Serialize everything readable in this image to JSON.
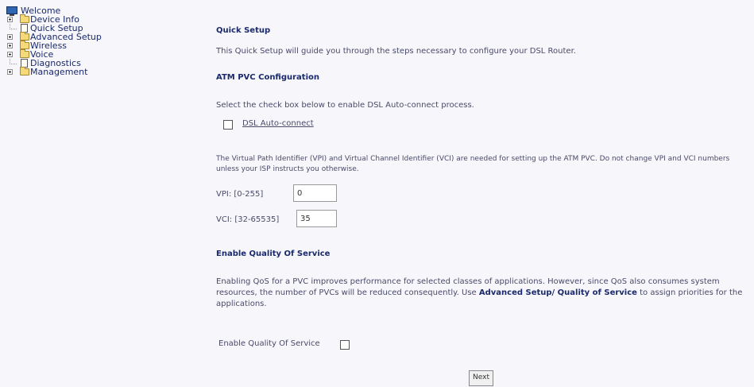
{
  "sidebar": {
    "items": [
      {
        "label": "Welcome"
      },
      {
        "label": "Device Info"
      },
      {
        "label": "Quick Setup"
      },
      {
        "label": "Advanced Setup"
      },
      {
        "label": "Wireless"
      },
      {
        "label": "Voice"
      },
      {
        "label": "Diagnostics"
      },
      {
        "label": "Management"
      }
    ]
  },
  "main": {
    "title": "Quick Setup",
    "intro": "This Quick Setup will guide you through the steps necessary to configure your DSL Router.",
    "atm": {
      "heading": "ATM PVC Configuration",
      "instruction": "Select the check box below to enable DSL Auto-connect process.",
      "auto_connect_label": "DSL Auto-connect",
      "description": "The Virtual Path Identifier (VPI) and Virtual Channel Identifier (VCI) are needed for setting up the ATM PVC. Do not change VPI and VCI numbers unless your ISP instructs you otherwise.",
      "vpi_label": "VPI: [0-255]",
      "vpi_value": "0",
      "vci_label": "VCI: [32-65535]",
      "vci_value": "35"
    },
    "qos": {
      "heading": "Enable Quality Of Service",
      "text_before": "Enabling QoS for a PVC improves performance for selected classes of applications. However, since QoS also consumes system resources, the number of PVCs will be reduced consequently. Use ",
      "link_text": "Advanced Setup/ Quality of Service",
      "text_after": " to assign priorities for the applications.",
      "enable_label": "Enable Quality Of Service"
    },
    "next_label": "Next"
  }
}
